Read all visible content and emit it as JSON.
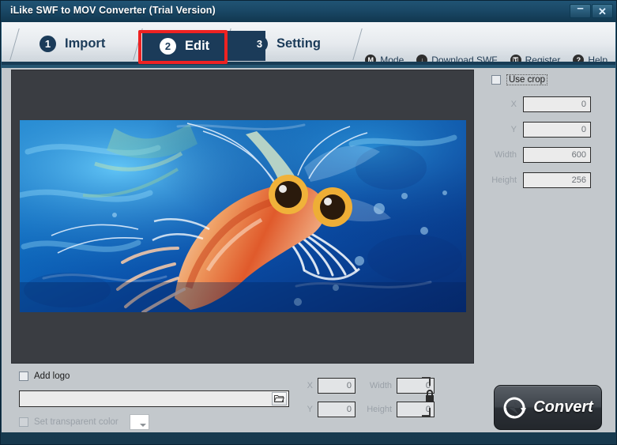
{
  "window": {
    "title": "iLike SWF to MOV Converter (Trial Version)",
    "minimize_label": "–",
    "close_label": "✕",
    "accent_red": "#ee2222",
    "titlebar_blue": "#1a4866",
    "tab_active_navy": "#1b3b59"
  },
  "tabs": [
    {
      "number": "1",
      "label": "Import",
      "active": false
    },
    {
      "number": "2",
      "label": "Edit",
      "active": true
    },
    {
      "number": "3",
      "label": "Setting",
      "active": false
    }
  ],
  "topmenu": [
    {
      "icon": "mode-icon",
      "glyph": "M",
      "label": "Mode"
    },
    {
      "icon": "download-icon",
      "glyph": "↓",
      "label": "Download SWF"
    },
    {
      "icon": "register-icon",
      "glyph": "⚿",
      "label": "Register"
    },
    {
      "icon": "help-icon",
      "glyph": "?",
      "label": "Help"
    }
  ],
  "crop": {
    "use_crop_label": "Use crop",
    "use_crop_checked": false,
    "fields": [
      {
        "label": "X",
        "value": "0"
      },
      {
        "label": "Y",
        "value": "0"
      },
      {
        "label": "Width",
        "value": "600"
      },
      {
        "label": "Height",
        "value": "256"
      }
    ]
  },
  "logo": {
    "add_logo_label": "Add logo",
    "add_logo_checked": false,
    "path_value": "",
    "path_placeholder": "",
    "browse_icon": "folder-open-icon",
    "transparent_label": "Set transparent color",
    "transparent_checked": false,
    "color_value": "#ffffff",
    "fields": [
      {
        "label": "X",
        "value": "0"
      },
      {
        "label": "Y",
        "value": "0"
      },
      {
        "label": "Width",
        "value": "0"
      },
      {
        "label": "Height",
        "value": "0"
      }
    ],
    "lock_icon": "aspect-ratio-lock-icon"
  },
  "convert": {
    "label": "Convert",
    "icon": "convert-refresh-icon"
  },
  "preview": {
    "image_name": "shrimp-underwater-frame",
    "background": "#3a3d42"
  }
}
